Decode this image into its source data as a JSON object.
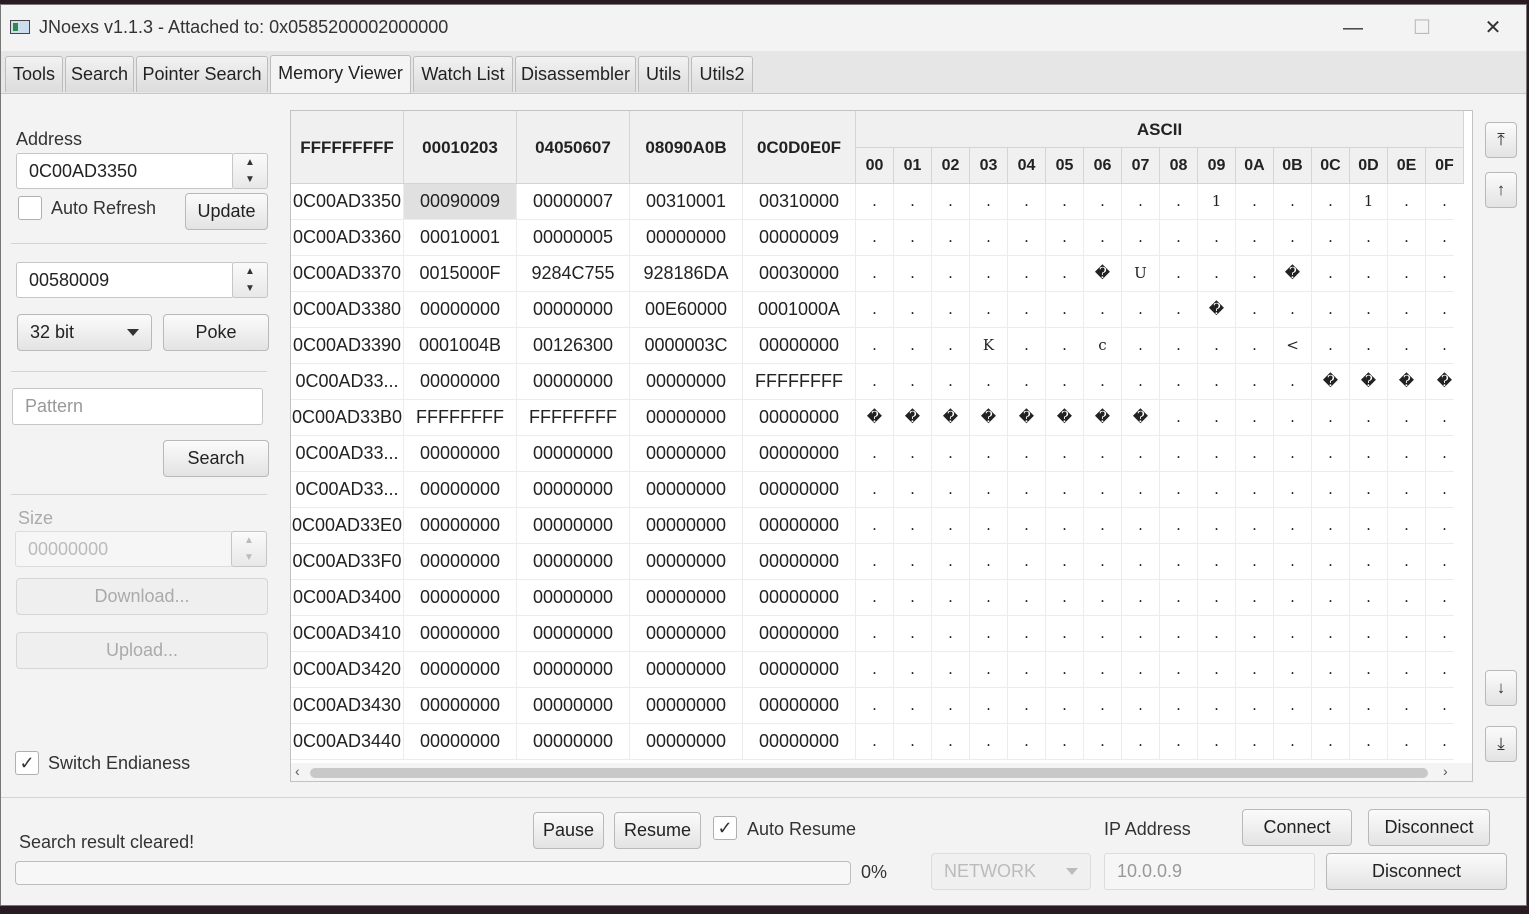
{
  "window": {
    "title": "JNoexs v1.1.3 - Attached to: 0x0585200002000000",
    "minimize": "—",
    "maximize": "☐",
    "close": "✕"
  },
  "tabs": [
    {
      "label": "Tools"
    },
    {
      "label": "Search"
    },
    {
      "label": "Pointer Search"
    },
    {
      "label": "Memory Viewer",
      "active": true
    },
    {
      "label": "Watch List"
    },
    {
      "label": "Disassembler"
    },
    {
      "label": "Utils"
    },
    {
      "label": "Utils2"
    }
  ],
  "left_panel": {
    "address_label": "Address",
    "address_value": "0C00AD3350",
    "auto_refresh_label": "Auto Refresh",
    "auto_refresh_checked": false,
    "update_button": "Update",
    "poke_value": "00580009",
    "bit_select": "32 bit",
    "poke_button": "Poke",
    "pattern_placeholder": "Pattern",
    "search_button": "Search",
    "size_label": "Size",
    "size_value": "00000000",
    "download_button": "Download...",
    "upload_button": "Upload...",
    "switch_endianess_label": "Switch Endianess",
    "switch_endianess_checked": true
  },
  "memory": {
    "headers": [
      "FFFFFFFFF",
      "00010203",
      "04050607",
      "08090A0B",
      "0C0D0E0F"
    ],
    "ascii_header": "ASCII",
    "ascii_columns": [
      "00",
      "01",
      "02",
      "03",
      "04",
      "05",
      "06",
      "07",
      "08",
      "09",
      "0A",
      "0B",
      "0C",
      "0D",
      "0E",
      "0F"
    ],
    "rows": [
      {
        "addr": "0C00AD3350",
        "w": [
          "00090009",
          "00000007",
          "00310001",
          "00310000"
        ],
        "ascii": [
          ".",
          ".",
          ".",
          ".",
          ".",
          ".",
          ".",
          ".",
          ".",
          "1",
          ".",
          ".",
          ".",
          "1",
          ".",
          "."
        ]
      },
      {
        "addr": "0C00AD3360",
        "w": [
          "00010001",
          "00000005",
          "00000000",
          "00000009"
        ],
        "ascii": [
          ".",
          ".",
          ".",
          ".",
          ".",
          ".",
          ".",
          ".",
          ".",
          ".",
          ".",
          ".",
          ".",
          ".",
          ".",
          "."
        ]
      },
      {
        "addr": "0C00AD3370",
        "w": [
          "0015000F",
          "9284C755",
          "928186DA",
          "00030000"
        ],
        "ascii": [
          ".",
          ".",
          ".",
          ".",
          ".",
          ".",
          "�",
          "U",
          ".",
          ".",
          ".",
          "�",
          ".",
          ".",
          ".",
          "."
        ]
      },
      {
        "addr": "0C00AD3380",
        "w": [
          "00000000",
          "00000000",
          "00E60000",
          "0001000A"
        ],
        "ascii": [
          ".",
          ".",
          ".",
          ".",
          ".",
          ".",
          ".",
          ".",
          ".",
          "�",
          ".",
          ".",
          ".",
          ".",
          ".",
          "."
        ]
      },
      {
        "addr": "0C00AD3390",
        "w": [
          "0001004B",
          "00126300",
          "0000003C",
          "00000000"
        ],
        "ascii": [
          ".",
          ".",
          ".",
          "K",
          ".",
          ".",
          "c",
          ".",
          ".",
          ".",
          ".",
          "<",
          ".",
          ".",
          ".",
          "."
        ]
      },
      {
        "addr": "0C00AD33...",
        "w": [
          "00000000",
          "00000000",
          "00000000",
          "FFFFFFFF"
        ],
        "ascii": [
          ".",
          ".",
          ".",
          ".",
          ".",
          ".",
          ".",
          ".",
          ".",
          ".",
          ".",
          ".",
          "�",
          "�",
          "�",
          "�"
        ]
      },
      {
        "addr": "0C00AD33B0",
        "w": [
          "FFFFFFFF",
          "FFFFFFFF",
          "00000000",
          "00000000"
        ],
        "ascii": [
          "�",
          "�",
          "�",
          "�",
          "�",
          "�",
          "�",
          "�",
          ".",
          ".",
          ".",
          ".",
          ".",
          ".",
          ".",
          "."
        ]
      },
      {
        "addr": "0C00AD33...",
        "w": [
          "00000000",
          "00000000",
          "00000000",
          "00000000"
        ],
        "ascii": [
          ".",
          ".",
          ".",
          ".",
          ".",
          ".",
          ".",
          ".",
          ".",
          ".",
          ".",
          ".",
          ".",
          ".",
          ".",
          "."
        ]
      },
      {
        "addr": "0C00AD33...",
        "w": [
          "00000000",
          "00000000",
          "00000000",
          "00000000"
        ],
        "ascii": [
          ".",
          ".",
          ".",
          ".",
          ".",
          ".",
          ".",
          ".",
          ".",
          ".",
          ".",
          ".",
          ".",
          ".",
          ".",
          "."
        ]
      },
      {
        "addr": "0C00AD33E0",
        "w": [
          "00000000",
          "00000000",
          "00000000",
          "00000000"
        ],
        "ascii": [
          ".",
          ".",
          ".",
          ".",
          ".",
          ".",
          ".",
          ".",
          ".",
          ".",
          ".",
          ".",
          ".",
          ".",
          ".",
          "."
        ]
      },
      {
        "addr": "0C00AD33F0",
        "w": [
          "00000000",
          "00000000",
          "00000000",
          "00000000"
        ],
        "ascii": [
          ".",
          ".",
          ".",
          ".",
          ".",
          ".",
          ".",
          ".",
          ".",
          ".",
          ".",
          ".",
          ".",
          ".",
          ".",
          "."
        ]
      },
      {
        "addr": "0C00AD3400",
        "w": [
          "00000000",
          "00000000",
          "00000000",
          "00000000"
        ],
        "ascii": [
          ".",
          ".",
          ".",
          ".",
          ".",
          ".",
          ".",
          ".",
          ".",
          ".",
          ".",
          ".",
          ".",
          ".",
          ".",
          "."
        ]
      },
      {
        "addr": "0C00AD3410",
        "w": [
          "00000000",
          "00000000",
          "00000000",
          "00000000"
        ],
        "ascii": [
          ".",
          ".",
          ".",
          ".",
          ".",
          ".",
          ".",
          ".",
          ".",
          ".",
          ".",
          ".",
          ".",
          ".",
          ".",
          "."
        ]
      },
      {
        "addr": "0C00AD3420",
        "w": [
          "00000000",
          "00000000",
          "00000000",
          "00000000"
        ],
        "ascii": [
          ".",
          ".",
          ".",
          ".",
          ".",
          ".",
          ".",
          ".",
          ".",
          ".",
          ".",
          ".",
          ".",
          ".",
          ".",
          "."
        ]
      },
      {
        "addr": "0C00AD3430",
        "w": [
          "00000000",
          "00000000",
          "00000000",
          "00000000"
        ],
        "ascii": [
          ".",
          ".",
          ".",
          ".",
          ".",
          ".",
          ".",
          ".",
          ".",
          ".",
          ".",
          ".",
          ".",
          ".",
          ".",
          "."
        ]
      },
      {
        "addr": "0C00AD3440",
        "w": [
          "00000000",
          "00000000",
          "00000000",
          "00000000"
        ],
        "ascii": [
          ".",
          ".",
          ".",
          ".",
          ".",
          ".",
          ".",
          ".",
          ".",
          ".",
          ".",
          ".",
          ".",
          ".",
          ".",
          "."
        ]
      }
    ]
  },
  "bottom": {
    "status": "Search result cleared!",
    "pause_button": "Pause",
    "resume_button": "Resume",
    "auto_resume_label": "Auto Resume",
    "auto_resume_checked": true,
    "progress_text": "0%",
    "progress_value": 0,
    "ip_label": "IP Address",
    "connect_button": "Connect",
    "disconnect_button_top": "Disconnect",
    "network_select": "NETWORK",
    "ip_value": "10.0.0.9",
    "disconnect_button_bottom": "Disconnect"
  },
  "scroll_icons": {
    "top": "⤒",
    "up": "↑",
    "down": "↓",
    "bottom": "⤓"
  }
}
